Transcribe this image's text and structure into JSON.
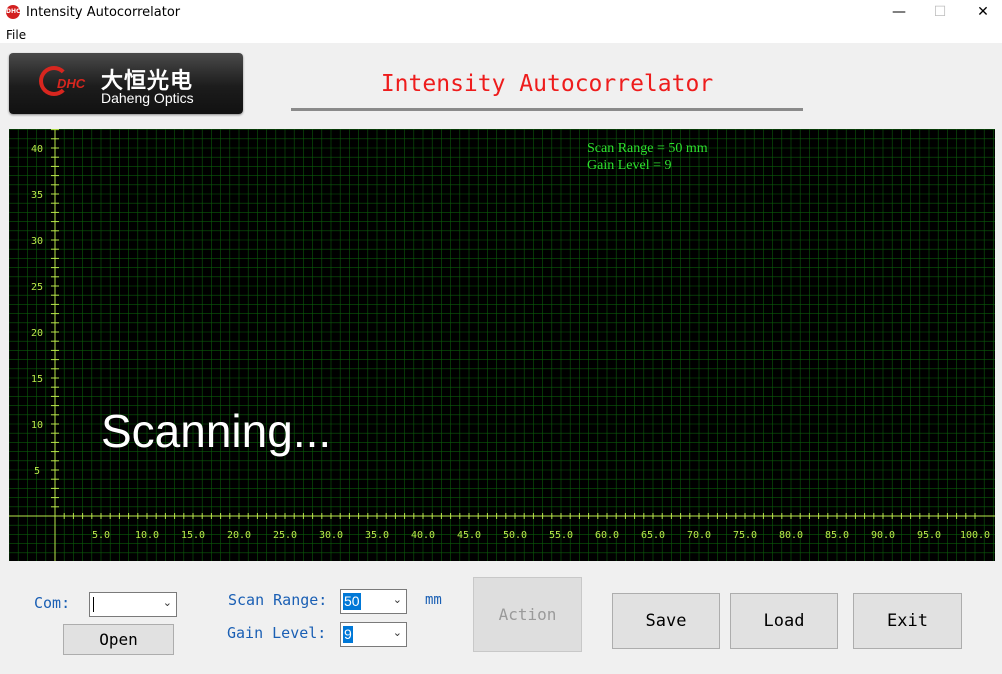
{
  "window": {
    "title": "Intensity Autocorrelator",
    "icon_text": "DHC",
    "minimize": "—",
    "maximize": "☐",
    "close": "✕"
  },
  "menu": {
    "file": "File"
  },
  "logo": {
    "abbr": "DHC",
    "chinese": "大恒光电",
    "english": "Daheng Optics"
  },
  "header": {
    "title": "Intensity Autocorrelator"
  },
  "plot": {
    "scan_range_readout": "Scan Range = 50 mm",
    "gain_readout": "Gain Level  = 9",
    "status": "Scanning...",
    "x_ticks": [
      "5.0",
      "10.0",
      "15.0",
      "20.0",
      "25.0",
      "30.0",
      "35.0",
      "40.0",
      "45.0",
      "50.0",
      "55.0",
      "60.0",
      "65.0",
      "70.0",
      "75.0",
      "80.0",
      "85.0",
      "90.0",
      "95.0",
      "100.0"
    ],
    "y_ticks": [
      "5",
      "10",
      "15",
      "20",
      "25",
      "30",
      "35",
      "40"
    ],
    "colors": {
      "background": "#000000",
      "grid": "#0b5a0b",
      "axis": "#b9e84a",
      "tick_label": "#b9e84a",
      "readout": "#2ee12e"
    }
  },
  "controls": {
    "com_label": "Com:",
    "com_value": "",
    "open_button": "Open",
    "scan_range_label": "Scan Range:",
    "scan_range_value": "50",
    "scan_range_unit": "mm",
    "gain_level_label": "Gain Level:",
    "gain_level_value": "9",
    "action_button": "Action",
    "save_button": "Save",
    "load_button": "Load",
    "exit_button": "Exit"
  }
}
